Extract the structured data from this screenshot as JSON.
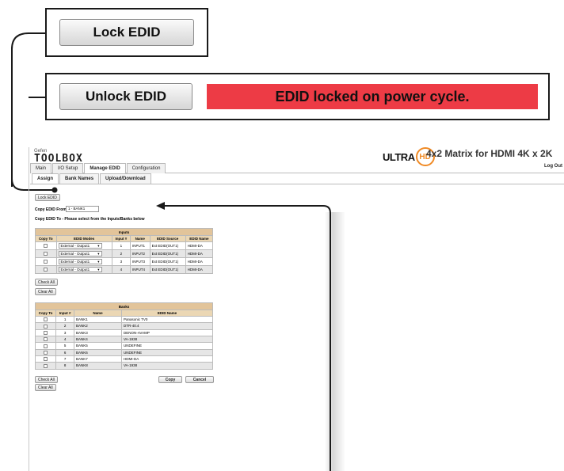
{
  "callouts": {
    "lock_button": "Lock EDID",
    "unlock_button": "Unlock EDID",
    "locked_banner": "EDID locked on power cycle.",
    "banner_color": "#ed3b45"
  },
  "header": {
    "logo_small": "Gefen",
    "logo_main": "TOOLBOX",
    "ultra_text": "ULTRA",
    "hd_text": "HD",
    "hd_color": "#f08a24",
    "product_title": "4x2 Matrix for HDMI 4K x 2K",
    "logout": "Log Out"
  },
  "main_tabs": [
    "Main",
    "I/O Setup",
    "Manage EDID",
    "Configuration"
  ],
  "main_tab_active": "Manage EDID",
  "sub_tabs": [
    "Assign",
    "Bank Names",
    "Upload/Download"
  ],
  "sub_tab_active": "Assign",
  "assign": {
    "lock_button": "Lock EDID",
    "copy_from_label": "Copy EDID From",
    "copy_from_value": "1 - BANK1",
    "copy_to_label": "Copy EDID To - Please select from the Inputs/Banks below"
  },
  "inputs_table": {
    "caption": "Inputs",
    "headers": [
      "Copy To",
      "EDID Modes",
      "Input #",
      "Name",
      "EDID Source",
      "EDID Name"
    ],
    "rows": [
      {
        "checked": false,
        "mode": "External - Output1",
        "num": "1",
        "name": "INPUT1",
        "source": "Ext EDID(OUT1)",
        "edid": "HDMI-DA"
      },
      {
        "checked": false,
        "mode": "External - Output1",
        "num": "2",
        "name": "INPUT2",
        "source": "Ext EDID(OUT1)",
        "edid": "HDMI-DA"
      },
      {
        "checked": false,
        "mode": "External - Output1",
        "num": "3",
        "name": "INPUT3",
        "source": "Ext EDID(OUT1)",
        "edid": "HDMI-DA"
      },
      {
        "checked": false,
        "mode": "External - Output1",
        "num": "4",
        "name": "INPUT4",
        "source": "Ext EDID(OUT1)",
        "edid": "HDMI-DA"
      }
    ]
  },
  "banks_table": {
    "caption": "Banks",
    "headers": [
      "Copy To",
      "Input #",
      "Name",
      "EDID Name"
    ],
    "rows": [
      {
        "checked": false,
        "num": "1",
        "name": "BANK1",
        "edid": "Panasonic TV0"
      },
      {
        "checked": false,
        "num": "2",
        "name": "BANK2",
        "edid": "DTR-40.4"
      },
      {
        "checked": false,
        "num": "3",
        "name": "BANK3",
        "edid": "DENON-AVAMP"
      },
      {
        "checked": false,
        "num": "4",
        "name": "BANK4",
        "edid": "VA-1938"
      },
      {
        "checked": false,
        "num": "5",
        "name": "BANK5",
        "edid": "UNDEFINE"
      },
      {
        "checked": false,
        "num": "6",
        "name": "BANK6",
        "edid": "UNDEFINE"
      },
      {
        "checked": false,
        "num": "7",
        "name": "BANK7",
        "edid": "HDMI-DA"
      },
      {
        "checked": false,
        "num": "8",
        "name": "BANK8",
        "edid": "VA-1938"
      }
    ]
  },
  "buttons": {
    "check_all": "Check All",
    "clear_all": "Clear All",
    "copy": "Copy",
    "cancel": "Cancel",
    "mode_arrow": "▾"
  }
}
